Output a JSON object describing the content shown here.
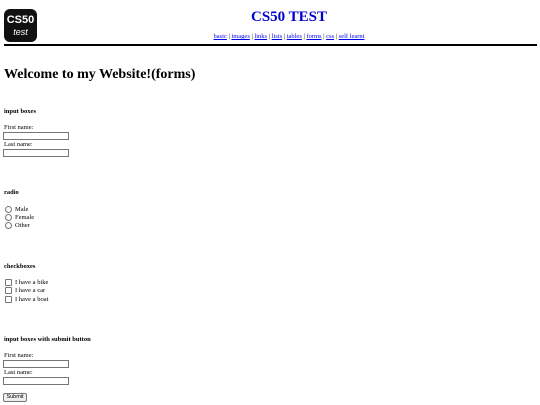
{
  "logo": {
    "top_text": "CS50",
    "bottom_text": "test"
  },
  "site_title": "CS50 TEST",
  "nav": {
    "items": [
      "basic",
      "images",
      "links",
      "lists",
      "tables",
      "forms",
      "css",
      "self learnt"
    ],
    "separator": "|"
  },
  "page_heading": "Welcome to my Website!(forms)",
  "sections": {
    "input_boxes": {
      "title": "input boxes",
      "first_label": "First name:",
      "last_label": "Last name:"
    },
    "radio": {
      "title": "radio",
      "options": [
        "Male",
        "Female",
        "Other"
      ]
    },
    "checkboxes": {
      "title": "checkboxes",
      "options": [
        "I have a bike",
        "I have a car",
        "I have a boat"
      ]
    },
    "submit_form": {
      "title": "input boxes with submit button",
      "first_label": "First name:",
      "last_label": "Last name:",
      "submit_label": "Submit"
    }
  }
}
